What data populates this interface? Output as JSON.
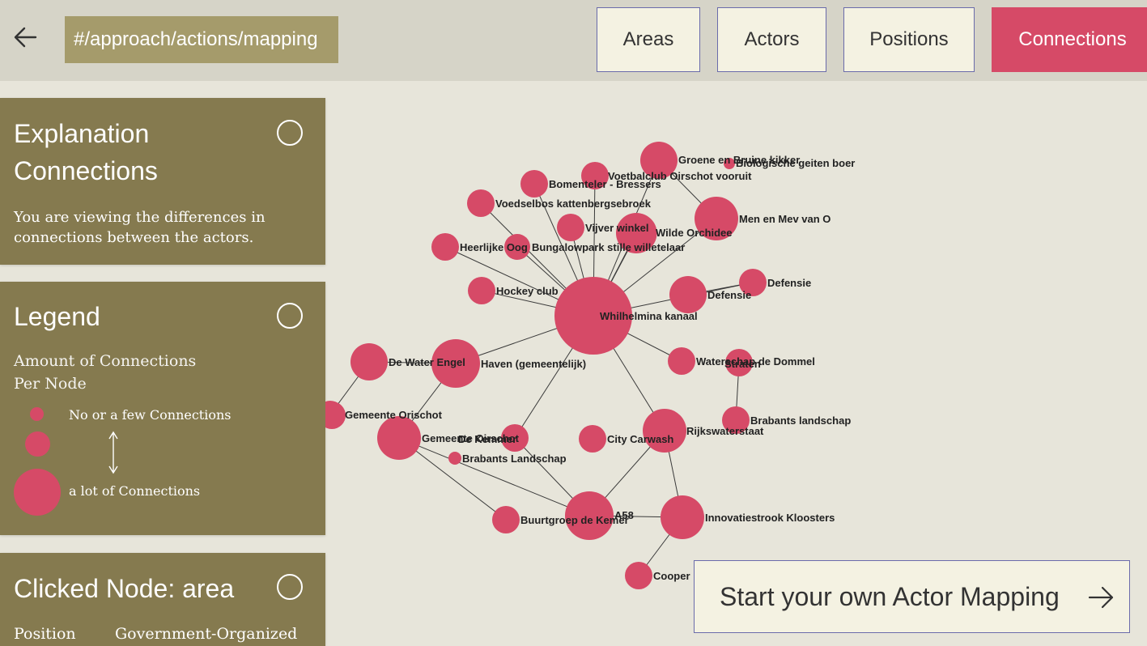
{
  "nav": {
    "url": "#/approach/actions/mapping",
    "tabs": [
      {
        "label": "Areas",
        "active": false
      },
      {
        "label": "Actors",
        "active": false
      },
      {
        "label": "Positions",
        "active": false
      },
      {
        "label": "Connections",
        "active": true
      }
    ]
  },
  "explanation": {
    "title": "Explanation\nConnections",
    "text": "You are viewing the differences in connections between the actors."
  },
  "legend": {
    "title": "Legend",
    "subtitle": "Amount of Connections\nPer Node",
    "few_label": "No or a few Connections",
    "many_label": "a lot of Connections"
  },
  "clicked": {
    "title": "Clicked Node: area",
    "position_label": "Position",
    "position_value": "Government-Organized"
  },
  "cta": {
    "label": "Start your own Actor Mapping"
  },
  "colors": {
    "accent": "#d64a67",
    "panel": "#857a4f",
    "url_bg": "#a59b6b",
    "background": "#e7e5da"
  },
  "graph": {
    "nodes": [
      {
        "id": "whilhelmina",
        "label": "Whilhelmina kanaal"
      },
      {
        "id": "groene",
        "label": "Groene en Bruine kikker"
      },
      {
        "id": "biogeiten",
        "label": "Biologische geiten boer"
      },
      {
        "id": "voetbal",
        "label": "Voetbalclub Oirschot vooruit"
      },
      {
        "id": "bomenteler",
        "label": "Bomenteler - Bressers"
      },
      {
        "id": "voedselbos",
        "label": "Voedselbos kattenbergsebroek"
      },
      {
        "id": "vijver",
        "label": "Vijver winkel"
      },
      {
        "id": "wilde",
        "label": "Wilde Orchidee"
      },
      {
        "id": "men",
        "label": "Men en Mev van O"
      },
      {
        "id": "heerlijke",
        "label": "Heerlijke Oog"
      },
      {
        "id": "bungalow",
        "label": "Bungalowpark stille willetelaar"
      },
      {
        "id": "hockey",
        "label": "Hockey club"
      },
      {
        "id": "defensie1",
        "label": "Defensie"
      },
      {
        "id": "defensie2",
        "label": "Defensie"
      },
      {
        "id": "dewater",
        "label": "De Water Engel"
      },
      {
        "id": "haven",
        "label": "Haven (gemeentelijk)"
      },
      {
        "id": "waterschap",
        "label": "Waterschap de Dommel"
      },
      {
        "id": "straten",
        "label": "Straten"
      },
      {
        "id": "orischot",
        "label": "Gemeente Orischot"
      },
      {
        "id": "oirschot",
        "label": "Gemeente Oirschot"
      },
      {
        "id": "kemmer",
        "label": "De Kemmer"
      },
      {
        "id": "carwash",
        "label": "City Carwash"
      },
      {
        "id": "rijkswater",
        "label": "Rijkswaterstaat"
      },
      {
        "id": "brabantsl",
        "label": "Brabants landschap"
      },
      {
        "id": "brabantsL2",
        "label": "Brabants Landschap"
      },
      {
        "id": "buurtgroep",
        "label": "Buurtgroep de Kemer"
      },
      {
        "id": "a58",
        "label": "A58"
      },
      {
        "id": "innovatie",
        "label": "Innovatiestrook Kloosters"
      },
      {
        "id": "cooper",
        "label": "Cooper"
      },
      {
        "id": "leftedge",
        "label": ""
      },
      {
        "id": "noname",
        "label": ""
      }
    ],
    "edges": [
      [
        "whilhelmina",
        "groene"
      ],
      [
        "whilhelmina",
        "voetbal"
      ],
      [
        "whilhelmina",
        "bomenteler"
      ],
      [
        "whilhelmina",
        "voedselbos"
      ],
      [
        "whilhelmina",
        "vijver"
      ],
      [
        "whilhelmina",
        "wilde"
      ],
      [
        "whilhelmina",
        "men"
      ],
      [
        "whilhelmina",
        "heerlijke"
      ],
      [
        "whilhelmina",
        "bungalow"
      ],
      [
        "whilhelmina",
        "hockey"
      ],
      [
        "whilhelmina",
        "defensie1"
      ],
      [
        "whilhelmina",
        "haven"
      ],
      [
        "whilhelmina",
        "waterschap"
      ],
      [
        "whilhelmina",
        "kemmer"
      ],
      [
        "whilhelmina",
        "rijkswater"
      ],
      [
        "whilhelmina",
        "noname"
      ],
      [
        "groene",
        "men"
      ],
      [
        "defensie1",
        "defensie2"
      ],
      [
        "straten",
        "brabantsl"
      ],
      [
        "haven",
        "dewater"
      ],
      [
        "haven",
        "oirschot"
      ],
      [
        "dewater",
        "orischot"
      ],
      [
        "leftedge",
        "orischot"
      ],
      [
        "oirschot",
        "a58"
      ],
      [
        "oirschot",
        "buurtgroep"
      ],
      [
        "kemmer",
        "a58"
      ],
      [
        "rijkswater",
        "a58"
      ],
      [
        "rijkswater",
        "innovatie"
      ],
      [
        "a58",
        "innovatie"
      ],
      [
        "innovatie",
        "cooper"
      ]
    ]
  }
}
